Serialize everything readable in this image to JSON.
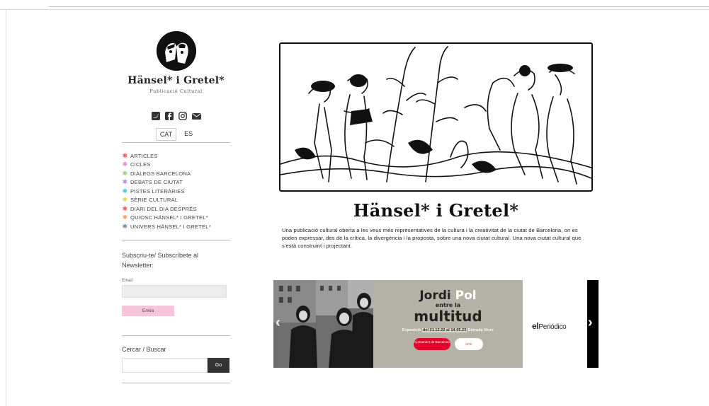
{
  "site": {
    "title": "Hänsel* i Gretel*",
    "subtitle": "Publicació Cultural"
  },
  "social_icons": [
    "twitter-icon",
    "facebook-icon",
    "instagram-icon",
    "mail-icon"
  ],
  "languages": [
    {
      "label": "CAT",
      "active": true
    },
    {
      "label": "ES",
      "active": false
    }
  ],
  "menu": [
    {
      "label": "ARTICLES",
      "color": "#f05a5a"
    },
    {
      "label": "CICLES",
      "color": "#e58ad8"
    },
    {
      "label": "DIÀLEGS BARCELONA",
      "color": "#9ad27a"
    },
    {
      "label": "DEBATS DE CIUTAT",
      "color": "#b28bd6"
    },
    {
      "label": "PISTES LITERÀRIES",
      "color": "#4fc3e8"
    },
    {
      "label": "SÈRIE CULTURAL",
      "color": "#e7d35c"
    },
    {
      "label": "DIARI DEL DIA DESPRÉS",
      "color": "#f05a5a"
    },
    {
      "label": "QUIOSC HÄNSEL* I GRETEL*",
      "color": "#f3a06b"
    },
    {
      "label": "UNIVERS HÄNSEL* I GRETEL*",
      "color": "#7b8ea8"
    }
  ],
  "newsletter": {
    "title": "Subscriu-te/ Subscríbete al Newsletter:",
    "email_label": "Email",
    "email_value": "",
    "send_label": "Envia"
  },
  "search": {
    "title": "Cercar / Buscar",
    "value": "",
    "button_label": "Go"
  },
  "main": {
    "title": "Hänsel* i Gretel*",
    "description": "Una publicació cultural oberta a les veus més representatives de la cultura i la creativitat de la ciutat de Barcelona, on es poden expressar, des de la crítica, la divergència i la proposta, sobre una nova ciutat cultural. Una nova ciutat cultural que s'està construint i projectant."
  },
  "banner": {
    "name_part1": "Jordi",
    "name_part2": "Pol",
    "line2": "entre la",
    "line3": "multitud",
    "expo_prefix": "Exposició",
    "expo_dates": "del 21.12.22 al 14.05.23",
    "expo_suffix": "Entrada lliure",
    "logo1": "Ajuntament de Barcelona",
    "logo2": "AFB",
    "sponsor_part1": "el",
    "sponsor_part2": "Periódico",
    "prev_arrow": "‹",
    "next_arrow": "›"
  }
}
